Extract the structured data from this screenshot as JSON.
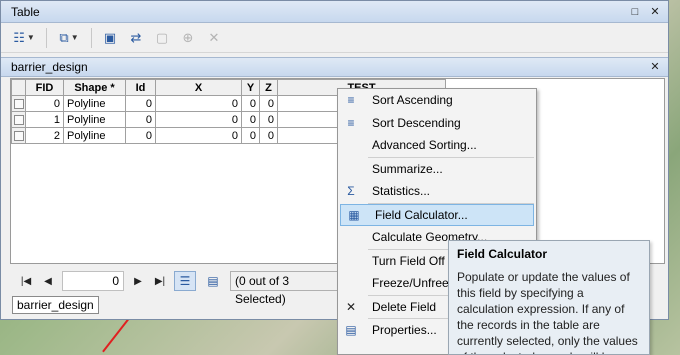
{
  "window": {
    "title": "Table",
    "controls": {
      "restore_glyph": "□",
      "close_glyph": "✕"
    }
  },
  "toolbar": {
    "buttons": [
      {
        "name": "table-options-icon",
        "glyph": "☷"
      },
      {
        "name": "related-tables-icon",
        "glyph": "⧉"
      },
      {
        "name": "select-by-attributes-icon",
        "glyph": "▣"
      },
      {
        "name": "switch-selection-icon",
        "glyph": "⇄"
      },
      {
        "name": "clear-selection-icon",
        "glyph": "▢"
      },
      {
        "name": "zoom-to-selected-icon",
        "glyph": "⊕"
      },
      {
        "name": "delete-selected-icon",
        "glyph": "✕"
      }
    ]
  },
  "tab": {
    "name": "barrier_design",
    "close_glyph": "✕"
  },
  "grid": {
    "columns": [
      "FID",
      "Shape *",
      "Id",
      "X",
      "Y",
      "Z",
      "TEST"
    ],
    "rows": [
      [
        "0",
        "Polyline",
        "0",
        "0",
        "0",
        "0",
        ""
      ],
      [
        "1",
        "Polyline",
        "0",
        "0",
        "0",
        "0",
        ""
      ],
      [
        "2",
        "Polyline",
        "0",
        "0",
        "0",
        "0",
        ""
      ]
    ]
  },
  "navigation": {
    "first_glyph": "|◀",
    "prev_glyph": "◀",
    "record_value": "0",
    "next_glyph": "▶",
    "last_glyph": "▶|",
    "selection_status": "(0 out of 3 Selected)"
  },
  "bottom_tab": {
    "label": "barrier_design"
  },
  "context_menu": {
    "items": [
      {
        "label": "Sort Ascending",
        "icon": "sort-ascending-icon",
        "glyph": "≡"
      },
      {
        "label": "Sort Descending",
        "icon": "sort-descending-icon",
        "glyph": "≡"
      },
      {
        "label": "Advanced Sorting...",
        "icon": "",
        "glyph": ""
      },
      {
        "label": "Summarize...",
        "icon": "",
        "glyph": ""
      },
      {
        "label": "Statistics...",
        "icon": "sigma-icon",
        "glyph": "Σ"
      },
      {
        "label": "Field Calculator...",
        "icon": "calculator-icon",
        "glyph": "▦"
      },
      {
        "label": "Calculate Geometry...",
        "icon": "",
        "glyph": ""
      },
      {
        "label": "Turn Field Off",
        "icon": "",
        "glyph": ""
      },
      {
        "label": "Freeze/Unfreeze Column",
        "icon": "",
        "glyph": ""
      },
      {
        "label": "Delete Field",
        "icon": "delete-icon",
        "glyph": "✕"
      },
      {
        "label": "Properties...",
        "icon": "properties-icon",
        "glyph": "▤"
      }
    ],
    "highlighted_index": 5
  },
  "tooltip": {
    "title": "Field Calculator",
    "body": "Populate or update the values of this field by specifying a calculation expression. If any of the records in the table are currently selected, only the values of the selected records will be"
  }
}
